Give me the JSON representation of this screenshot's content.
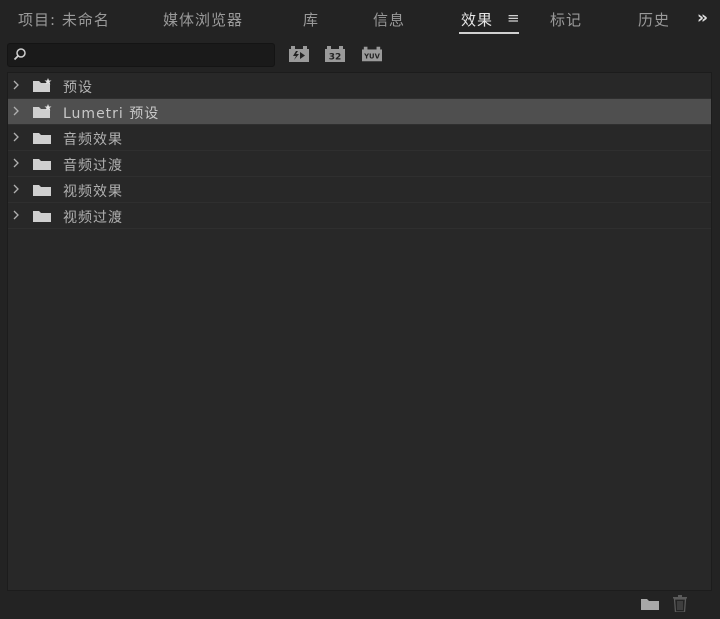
{
  "tabs": [
    {
      "label": "项目: 未命名",
      "active": false
    },
    {
      "label": "媒体浏览器",
      "active": false
    },
    {
      "label": "库",
      "active": false
    },
    {
      "label": "信息",
      "active": false
    },
    {
      "label": "效果",
      "active": true
    },
    {
      "label": "标记",
      "active": false
    },
    {
      "label": "历史",
      "active": false
    }
  ],
  "tab_menu_icon": "hamburger-menu-icon",
  "overflow_label": "»",
  "search": {
    "value": "",
    "placeholder": ""
  },
  "filter_buttons": [
    {
      "icon": "accelerated-effects-icon",
      "label": "⚡▶"
    },
    {
      "icon": "32-bit-color-icon",
      "label": "32"
    },
    {
      "icon": "yuv-effects-icon",
      "label": "YUV"
    }
  ],
  "tree": [
    {
      "label": "预设",
      "icon": "preset-folder-icon",
      "selected": false
    },
    {
      "label": "Lumetri 预设",
      "icon": "preset-folder-icon",
      "selected": true
    },
    {
      "label": "音频效果",
      "icon": "folder-icon",
      "selected": false
    },
    {
      "label": "音频过渡",
      "icon": "folder-icon",
      "selected": false
    },
    {
      "label": "视频效果",
      "icon": "folder-icon",
      "selected": false
    },
    {
      "label": "视频过渡",
      "icon": "folder-icon",
      "selected": false
    }
  ],
  "colors": {
    "background": "#232323",
    "panel": "#282828",
    "selected_row": "#4f4f4f",
    "active_tab": "#e6e6e6"
  }
}
